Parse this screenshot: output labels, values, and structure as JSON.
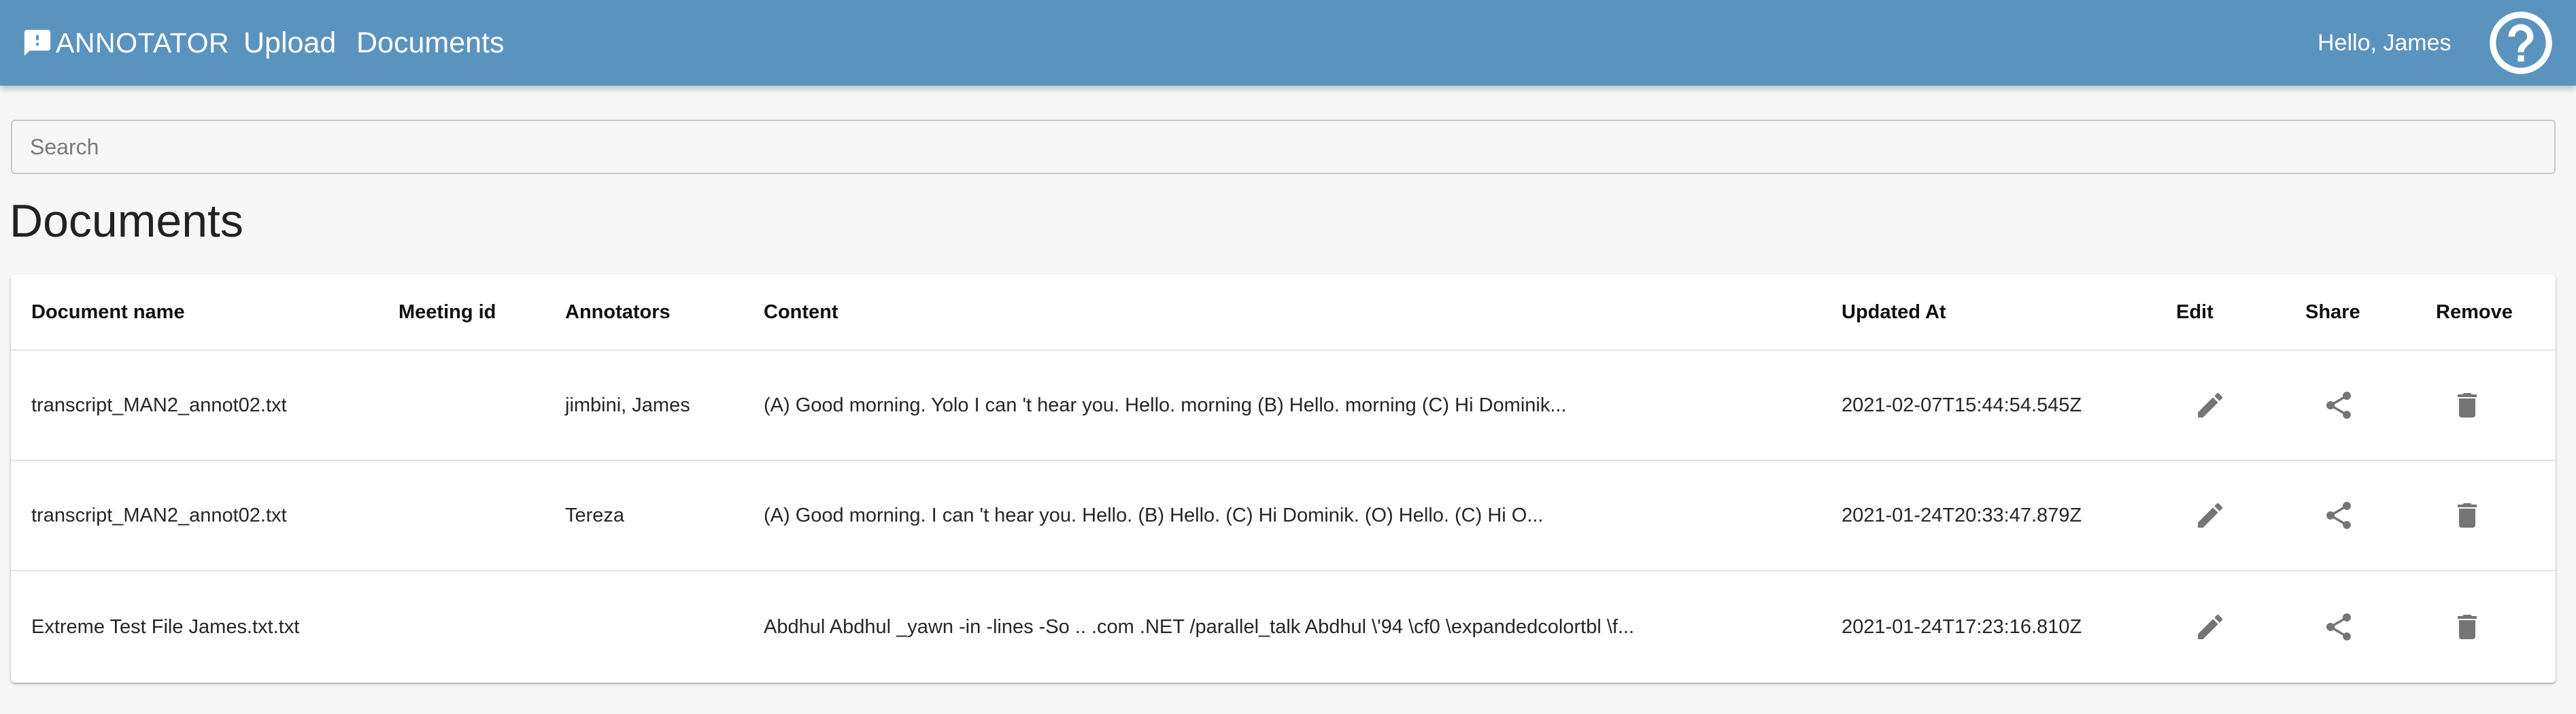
{
  "app": {
    "brand": "ANNOTATOR",
    "nav": {
      "upload": "Upload",
      "documents": "Documents"
    },
    "greeting": "Hello, James",
    "colors": {
      "appbar": "#5b93bf",
      "icon": "#757575"
    },
    "icons": {
      "brand": "feedback-icon",
      "help": "help-circle-icon"
    }
  },
  "search": {
    "placeholder": "Search",
    "value": ""
  },
  "page_title": "Documents",
  "table": {
    "headers": {
      "name": "Document name",
      "meeting": "Meeting id",
      "annotators": "Annotators",
      "content": "Content",
      "updated": "Updated At",
      "edit": "Edit",
      "share": "Share",
      "remove": "Remove"
    },
    "rows": [
      {
        "name": "transcript_MAN2_annot02.txt",
        "meeting": "",
        "annotators": "jimbini, James",
        "content": "(A) Good morning. Yolo I can 't hear you.  Hello.  morning (B) Hello.  morning (C) Hi Dominik...",
        "updated": "2021-02-07T15:44:54.545Z"
      },
      {
        "name": "transcript_MAN2_annot02.txt",
        "meeting": "",
        "annotators": "Tereza",
        "content": "(A) Good morning.  I can 't hear you.  Hello.  (B) Hello.  (C) Hi Dominik. (O) Hello. (C) Hi O...",
        "updated": "2021-01-24T20:33:47.879Z"
      },
      {
        "name": "Extreme Test File James.txt.txt",
        "meeting": "",
        "annotators": "",
        "content": "Abdhul Abdhul _yawn -in -lines -So .. .com .NET /parallel_talk Abdhul \\'94 \\cf0 \\expandedcolortbl \\f...",
        "updated": "2021-01-24T17:23:16.810Z"
      }
    ],
    "row_icons": {
      "edit": "pencil-icon",
      "share": "share-icon",
      "remove": "trash-icon"
    }
  }
}
